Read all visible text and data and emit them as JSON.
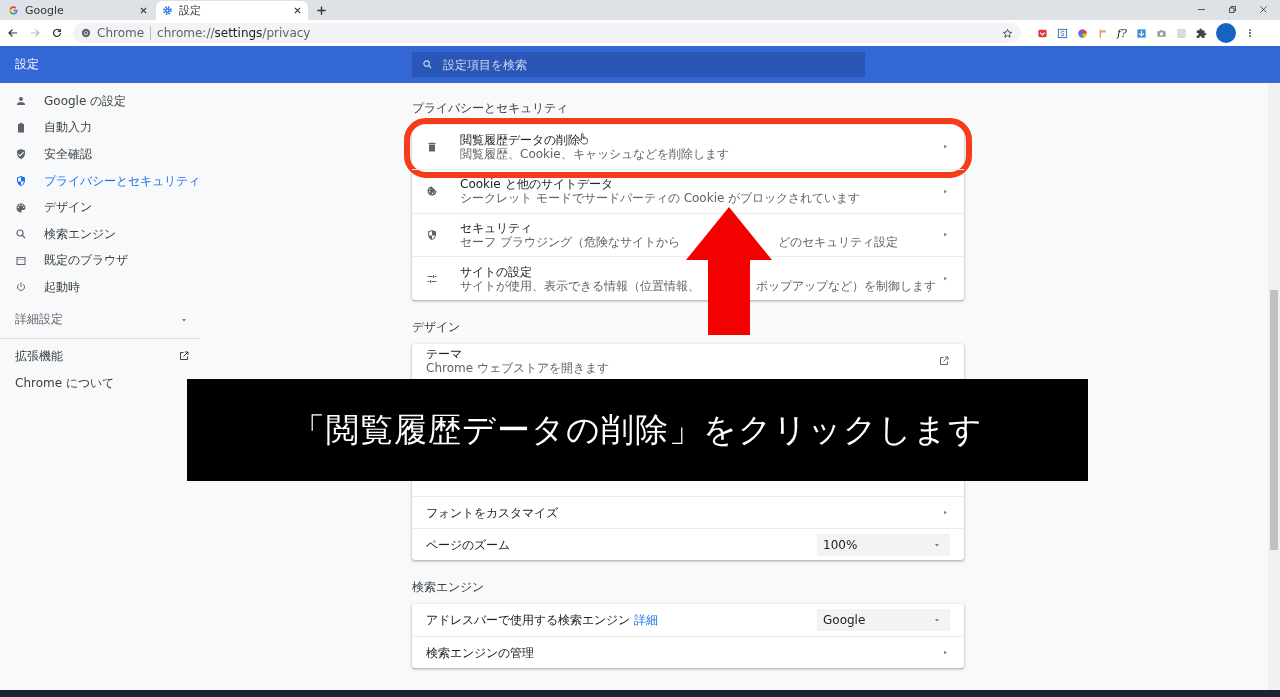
{
  "browser": {
    "tabs": [
      {
        "title": "Google",
        "selected": false
      },
      {
        "title": "設定",
        "selected": true
      }
    ],
    "nav": {
      "back_disabled": false,
      "forward_disabled": true
    },
    "address": {
      "origin": "Chrome",
      "scheme": "chrome://",
      "host": "settings",
      "path": "/privacy"
    },
    "extension_text": "f?"
  },
  "header": {
    "title": "設定",
    "search": {
      "placeholder": "設定項目を検索"
    }
  },
  "sidebar": {
    "items": [
      {
        "label": "Google の設定",
        "selected": false
      },
      {
        "label": "自動入力",
        "selected": false
      },
      {
        "label": "安全確認",
        "selected": false
      },
      {
        "label": "プライバシーとセキュリティ",
        "selected": true
      },
      {
        "label": "デザイン",
        "selected": false
      },
      {
        "label": "検索エンジン",
        "selected": false
      },
      {
        "label": "既定のブラウザ",
        "selected": false
      },
      {
        "label": "起動時",
        "selected": false
      }
    ],
    "advanced": {
      "label": "詳細設定",
      "expanded": false
    },
    "links": [
      {
        "label": "拡張機能",
        "kind": "external"
      },
      {
        "label": "Chrome について",
        "kind": "plain"
      }
    ]
  },
  "sections": [
    {
      "title": "プライバシーとセキュリティ",
      "rows": [
        {
          "kind": "nav",
          "title": "閲覧履歴データの削除",
          "description": "閲覧履歴、Cookie、キャッシュなどを削除します",
          "highlighted": true
        },
        {
          "kind": "nav",
          "title": "Cookie と他のサイトデータ",
          "description": "シークレット モードでサードパーティの Cookie がブロックされています",
          "highlighted": false
        },
        {
          "kind": "nav",
          "title": "セキュリティ",
          "description_parts": [
            "セーフ ブラウジング（危険なサイトから",
            "どのセキュリティ設定"
          ],
          "highlighted": false
        },
        {
          "kind": "nav",
          "title": "サイトの設定",
          "description_parts": [
            "サイトが使用、表示できる情報（位置情報、",
            "ポップアップなど）を制御します"
          ],
          "highlighted": false
        }
      ]
    },
    {
      "title": "デザイン",
      "rows": [
        {
          "kind": "external",
          "title": "テーマ",
          "description": "Chrome ウェブストアを開きます"
        },
        {
          "kind": "nav",
          "title": "フォントをカスタマイズ"
        },
        {
          "kind": "select",
          "title": "ページのズーム",
          "value": "100%"
        }
      ]
    },
    {
      "title": "検索エンジン",
      "rows": [
        {
          "kind": "select",
          "title": "アドレスバーで使用する検索エンジン",
          "link": "詳細",
          "value": "Google"
        },
        {
          "kind": "nav",
          "title": "検索エンジンの管理"
        }
      ]
    }
  ],
  "overlay": {
    "caption": "「閲覧履歴データの削除」をクリックします"
  }
}
